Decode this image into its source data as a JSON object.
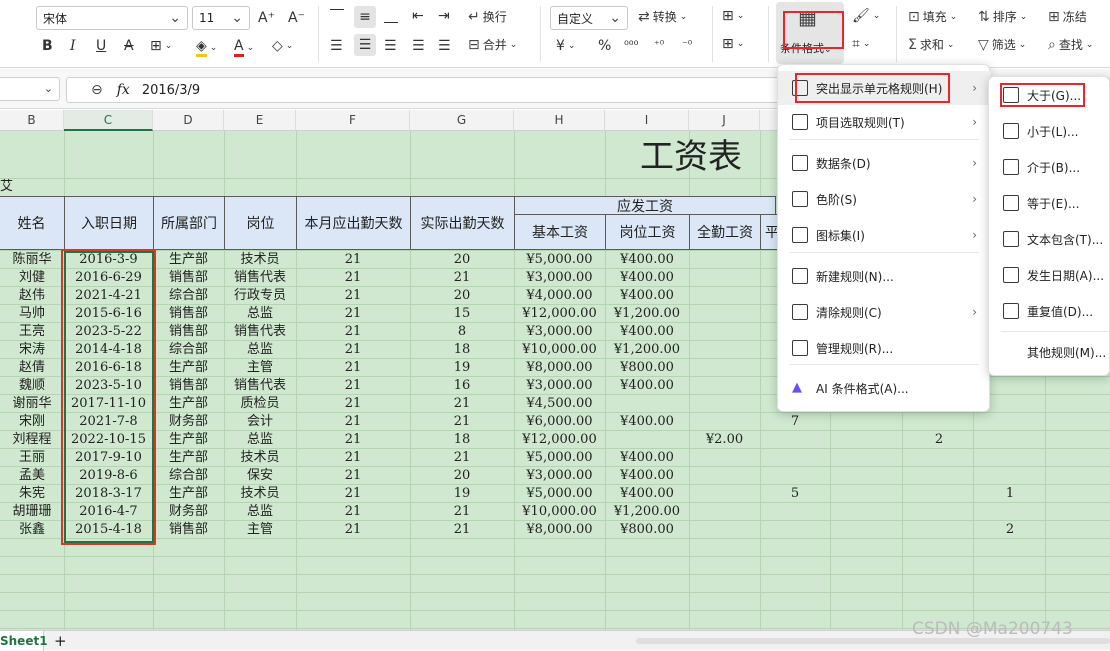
{
  "toolbar": {
    "font_name": "宋体",
    "font_size": "11",
    "grow_font": "A⁺",
    "shrink_font": "A⁻",
    "wrap_label": "换行",
    "merge_label": "合并",
    "number_format": "自定义",
    "convert_label": "转换",
    "cond_format_label": "条件格式",
    "fill_label": "填充",
    "sort_label": "排序",
    "freeze_label": "冻结",
    "sum_label": "求和",
    "filter_label": "筛选",
    "find_label": "查找"
  },
  "formula": {
    "fx": "fx",
    "value": "2016/3/9"
  },
  "columns": [
    "B",
    "C",
    "D",
    "E",
    "F",
    "G",
    "H",
    "I",
    "J"
  ],
  "sheet": {
    "title": "工资表",
    "row_partial": "艾",
    "group_header": "应发工资",
    "partial_header": "平",
    "headers": [
      "姓名",
      "入职日期",
      "所属部门",
      "岗位",
      "本月应出勤天数",
      "实际出勤天数",
      "基本工资",
      "岗位工资",
      "全勤工资"
    ],
    "rows": [
      [
        "陈丽华",
        "2016-3-9",
        "生产部",
        "技术员",
        "21",
        "20",
        "¥5,000.00",
        "¥400.00",
        "",
        "",
        ""
      ],
      [
        "刘健",
        "2016-6-29",
        "销售部",
        "销售代表",
        "21",
        "21",
        "¥3,000.00",
        "¥400.00",
        "",
        "",
        ""
      ],
      [
        "赵伟",
        "2021-4-21",
        "综合部",
        "行政专员",
        "21",
        "20",
        "¥4,000.00",
        "¥400.00",
        "",
        "",
        ""
      ],
      [
        "马帅",
        "2015-6-16",
        "销售部",
        "总监",
        "21",
        "15",
        "¥12,000.00",
        "¥1,200.00",
        "",
        "",
        ""
      ],
      [
        "王亮",
        "2023-5-22",
        "销售部",
        "销售代表",
        "21",
        "8",
        "¥3,000.00",
        "¥400.00",
        "",
        "",
        ""
      ],
      [
        "宋涛",
        "2014-4-18",
        "综合部",
        "总监",
        "21",
        "18",
        "¥10,000.00",
        "¥1,200.00",
        "",
        "",
        ""
      ],
      [
        "赵倩",
        "2016-6-18",
        "生产部",
        "主管",
        "21",
        "19",
        "¥8,000.00",
        "¥800.00",
        "",
        "",
        ""
      ],
      [
        "魏顺",
        "2023-5-10",
        "销售部",
        "销售代表",
        "21",
        "16",
        "¥3,000.00",
        "¥400.00",
        "",
        "",
        ""
      ],
      [
        "谢丽华",
        "2017-11-10",
        "生产部",
        "质检员",
        "21",
        "21",
        "¥4,500.00",
        "",
        "",
        "",
        ""
      ],
      [
        "宋刚",
        "2021-7-8",
        "财务部",
        "会计",
        "21",
        "21",
        "¥6,000.00",
        "¥400.00",
        "",
        "7",
        ""
      ],
      [
        "刘程程",
        "2022-10-15",
        "生产部",
        "总监",
        "21",
        "18",
        "¥12,000.00",
        "",
        "¥2.00",
        "",
        "2"
      ],
      [
        "王丽",
        "2017-9-10",
        "生产部",
        "技术员",
        "21",
        "21",
        "¥5,000.00",
        "¥400.00",
        "",
        "",
        ""
      ],
      [
        "孟美",
        "2019-8-6",
        "综合部",
        "保安",
        "21",
        "20",
        "¥3,000.00",
        "¥400.00",
        "",
        "",
        ""
      ],
      [
        "朱宪",
        "2018-3-17",
        "生产部",
        "技术员",
        "21",
        "19",
        "¥5,000.00",
        "¥400.00",
        "",
        "5",
        ""
      ],
      [
        "胡珊珊",
        "2016-4-7",
        "财务部",
        "总监",
        "21",
        "21",
        "¥10,000.00",
        "¥1,200.00",
        "",
        "",
        ""
      ],
      [
        "张鑫",
        "2015-4-18",
        "销售部",
        "主管",
        "21",
        "21",
        "¥8,000.00",
        "¥800.00",
        "",
        "",
        ""
      ]
    ],
    "extra_right": [
      {
        "row": 13,
        "value": "1"
      },
      {
        "row": 15,
        "value": "2"
      }
    ]
  },
  "menu": {
    "items": [
      {
        "label": "突出显示单元格规则(H)",
        "icon": "highlight-rules-icon",
        "submenu": true
      },
      {
        "label": "项目选取规则(T)",
        "icon": "top-bottom-rules-icon",
        "submenu": true
      },
      {
        "label": "数据条(D)",
        "icon": "data-bars-icon",
        "submenu": true
      },
      {
        "label": "色阶(S)",
        "icon": "color-scale-icon",
        "submenu": true
      },
      {
        "label": "图标集(I)",
        "icon": "icon-sets-icon",
        "submenu": true
      },
      {
        "label": "新建规则(N)...",
        "icon": "new-rule-icon",
        "submenu": false
      },
      {
        "label": "清除规则(C)",
        "icon": "clear-rules-icon",
        "submenu": true
      },
      {
        "label": "管理规则(R)...",
        "icon": "manage-rules-icon",
        "submenu": false
      },
      {
        "label": "AI 条件格式(A)...",
        "icon": "ai-icon",
        "submenu": false
      }
    ]
  },
  "submenu": {
    "items": [
      {
        "label": "大于(G)...",
        "icon": "greater-than-icon"
      },
      {
        "label": "小于(L)...",
        "icon": "less-than-icon"
      },
      {
        "label": "介于(B)...",
        "icon": "between-icon"
      },
      {
        "label": "等于(E)...",
        "icon": "equal-icon"
      },
      {
        "label": "文本包含(T)...",
        "icon": "text-contains-icon"
      },
      {
        "label": "发生日期(A)...",
        "icon": "date-occurring-icon"
      },
      {
        "label": "重复值(D)...",
        "icon": "duplicate-values-icon"
      },
      {
        "label": "其他规则(M)...",
        "icon": ""
      }
    ]
  },
  "statusbar": {
    "sheet_tab": "Sheet1",
    "add": "+"
  },
  "watermark": "CSDN @Ma200743"
}
